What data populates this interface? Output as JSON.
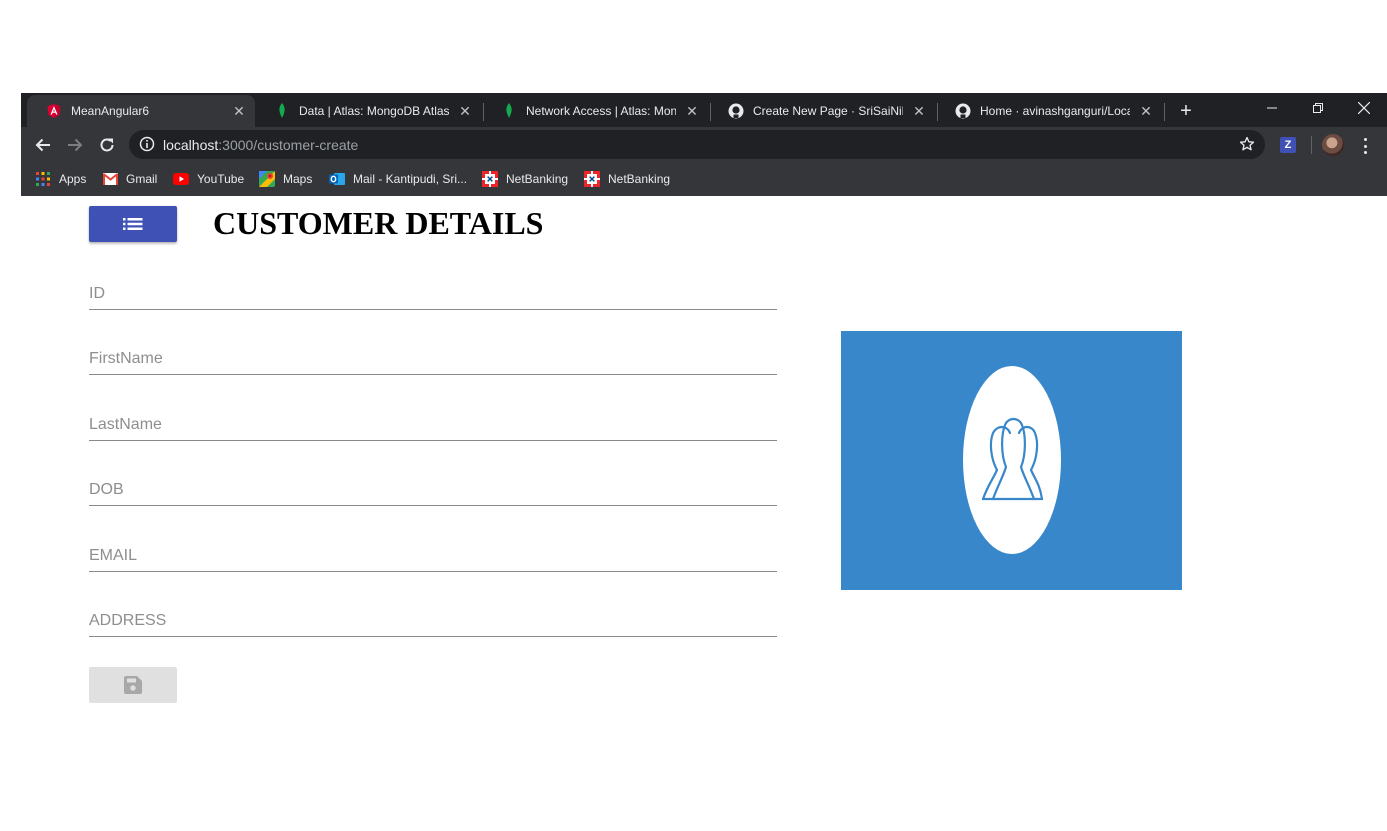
{
  "browser": {
    "tabs": [
      {
        "title": "MeanAngular6",
        "icon": "angular-icon"
      },
      {
        "title": "Data | Atlas: MongoDB Atlas",
        "icon": "mongodb-leaf-icon"
      },
      {
        "title": "Network Access | Atlas: MongoDB Atlas",
        "icon": "mongodb-leaf-icon"
      },
      {
        "title": "Create New Page · SriSaiNikhil",
        "icon": "github-icon"
      },
      {
        "title": "Home · avinashganguri/Location",
        "icon": "github-icon"
      }
    ],
    "close_glyph": "✕",
    "new_tab_glyph": "+",
    "url": {
      "host": "localhost",
      "path": ":3000/customer-create"
    },
    "bookmarks": [
      {
        "label": "Apps",
        "icon": "apps-grid-icon"
      },
      {
        "label": "Gmail",
        "icon": "gmail-icon"
      },
      {
        "label": "YouTube",
        "icon": "youtube-icon"
      },
      {
        "label": "Maps",
        "icon": "maps-icon"
      },
      {
        "label": "Mail - Kantipudi, Sri...",
        "icon": "outlook-icon"
      },
      {
        "label": "NetBanking",
        "icon": "hdfc-icon"
      },
      {
        "label": "NetBanking",
        "icon": "hdfc-icon"
      }
    ],
    "extension_label": "Z"
  },
  "page": {
    "title": "CUSTOMER DETAILS",
    "accent_color": "#3f51b5",
    "fields": [
      {
        "placeholder": "ID"
      },
      {
        "placeholder": "FirstName"
      },
      {
        "placeholder": "LastName"
      },
      {
        "placeholder": "DOB"
      },
      {
        "placeholder": "EMAIL"
      },
      {
        "placeholder": "ADDRESS"
      }
    ],
    "image_background": "#3887cb"
  }
}
